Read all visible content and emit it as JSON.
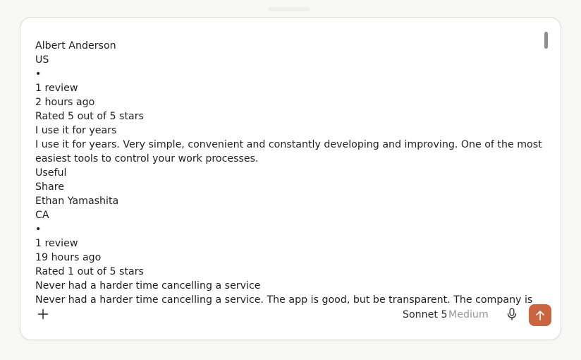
{
  "composer": {
    "lines": [
      "Albert Anderson",
      "US",
      "•",
      "1 review",
      "2 hours ago",
      "Rated 5 out of 5 stars",
      "I use it for years",
      "I use it for years. Very simple, convenient and constantly developing and improving. One of the most easiest tools to control your work processes.",
      "Useful",
      "Share",
      "Ethan Yamashita",
      "CA",
      "•",
      "1 review",
      "19 hours ago",
      "Rated 1 out of 5 stars",
      "Never had a harder time cancelling a service",
      "Never had a harder time cancelling a service. The app is good, but be transparent. The company is like"
    ]
  },
  "toolbar": {
    "add_icon": "plus-icon",
    "model_name": "Sonnet 5",
    "model_effort": "Medium",
    "mic_icon": "microphone-icon",
    "send_icon": "arrow-up-icon"
  },
  "colors": {
    "accent": "#c9653f",
    "text": "#1f1f1e",
    "muted": "#9a9894"
  }
}
